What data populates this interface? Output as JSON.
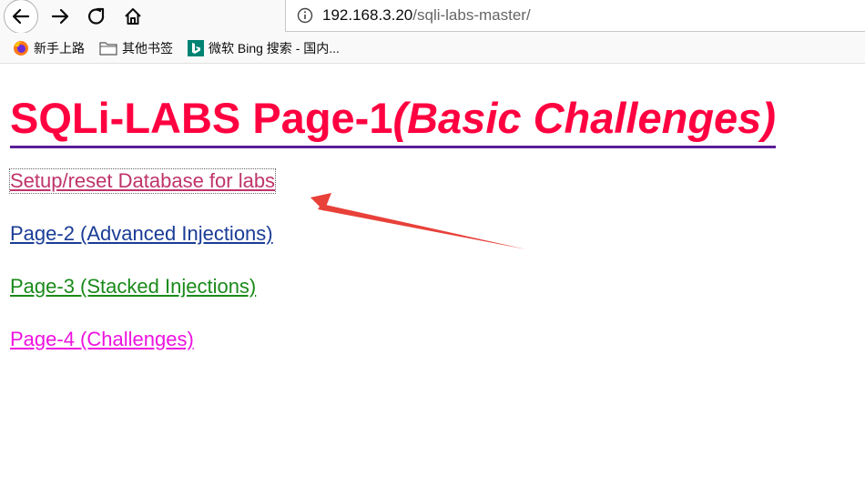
{
  "browser": {
    "url_host": "192.168.3.20",
    "url_path": "/sqli-labs-master/",
    "bookmarks": [
      {
        "label": "新手上路",
        "icon": "firefox-icon"
      },
      {
        "label": "其他书签",
        "icon": "folder-icon"
      },
      {
        "label": "微软 Bing 搜索 - 国内...",
        "icon": "bing-icon"
      }
    ]
  },
  "page": {
    "title_main": "SQLi-LABS Page-1",
    "title_sub": "(Basic Challenges)",
    "title_color": "#ff0040",
    "links": [
      {
        "label": "Setup/reset Database for labs",
        "color": "#c0346a"
      },
      {
        "label": "Page-2 (Advanced Injections)",
        "color": "#1a3c96"
      },
      {
        "label": "Page-3 (Stacked Injections)",
        "color": "#1a8a1a"
      },
      {
        "label": "Page-4 (Challenges)",
        "color": "#ee12e0"
      }
    ]
  },
  "annotation": {
    "type": "red-arrow",
    "color": "#e8413a"
  }
}
